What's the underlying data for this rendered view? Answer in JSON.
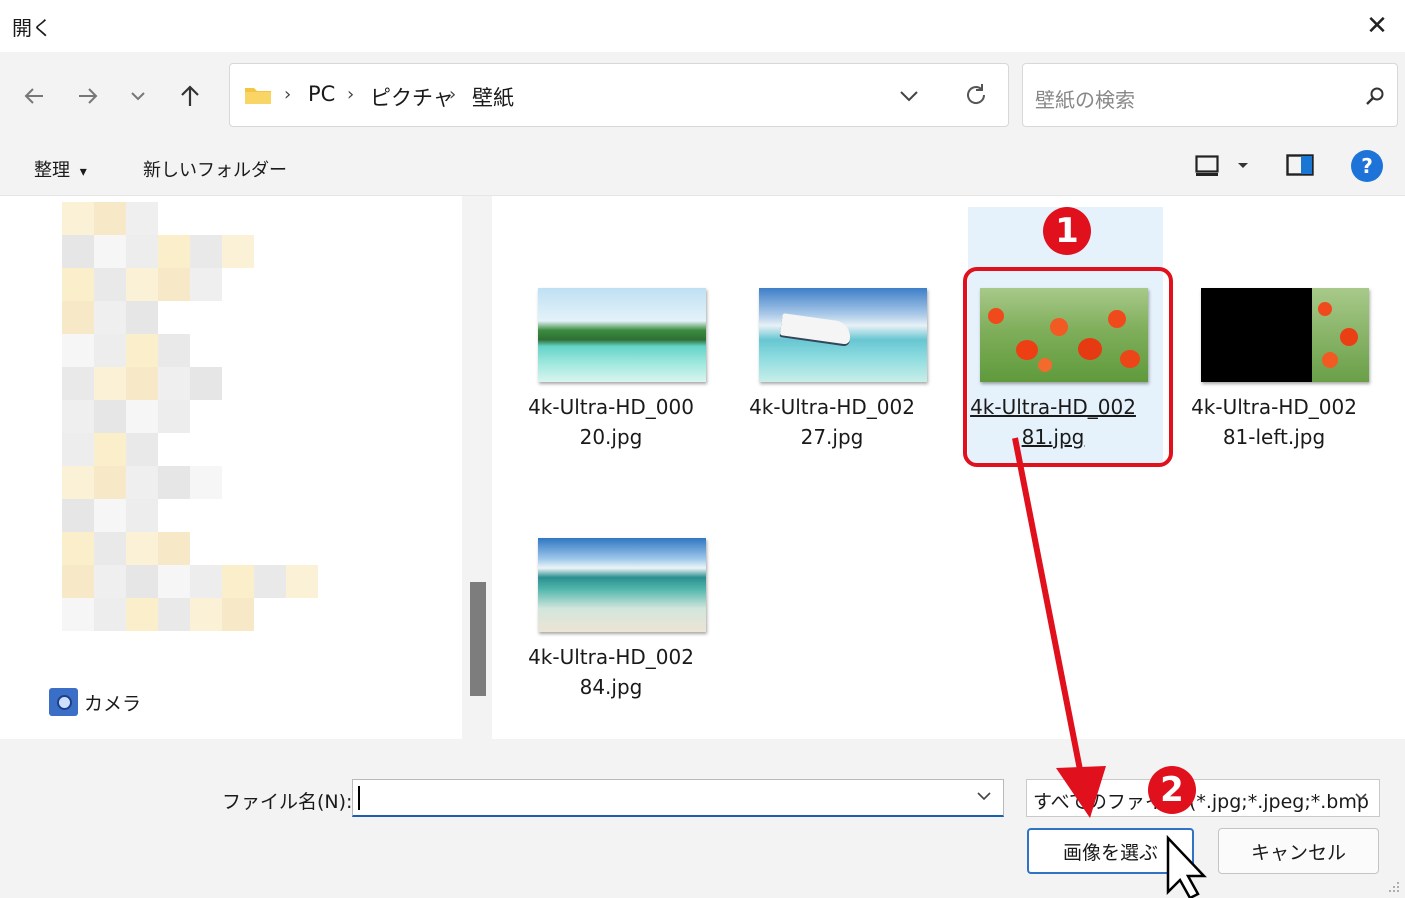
{
  "window": {
    "title": "開く",
    "close_label": "✕"
  },
  "nav": {
    "back_icon": "arrow-left-icon",
    "forward_icon": "arrow-right-icon",
    "recent_icon": "chevron-down-icon",
    "up_icon": "arrow-up-icon"
  },
  "address": {
    "crumbs": [
      "PC",
      "ピクチャ",
      "壁紙"
    ],
    "separator": "›"
  },
  "search": {
    "placeholder": "壁紙の検索"
  },
  "commands": {
    "organize": "整理",
    "organize_arrow": "▾",
    "new_folder": "新しいフォルダー"
  },
  "left_pane": {
    "camera_label": "カメラ"
  },
  "files": [
    {
      "name_line1": "4k-Ultra-HD_000",
      "name_line2": "20.jpg"
    },
    {
      "name_line1": "4k-Ultra-HD_002",
      "name_line2": "27.jpg"
    },
    {
      "name_line1": "4k-Ultra-HD_002",
      "name_line2": "81.jpg"
    },
    {
      "name_line1": "4k-Ultra-HD_002",
      "name_line2": "81-left.jpg"
    },
    {
      "name_line1": "4k-Ultra-HD_002",
      "name_line2": "84.jpg"
    }
  ],
  "bottom": {
    "filename_label": "ファイル名(N):",
    "filename_value": "",
    "filter_text": "すべてのファイル (*.jpg;*.jpeg;*.bmp",
    "ok_label": "画像を選ぶ",
    "cancel_label": "キャンセル"
  },
  "annotations": {
    "step1": "1",
    "step2": "2",
    "color": "#e0101c"
  }
}
